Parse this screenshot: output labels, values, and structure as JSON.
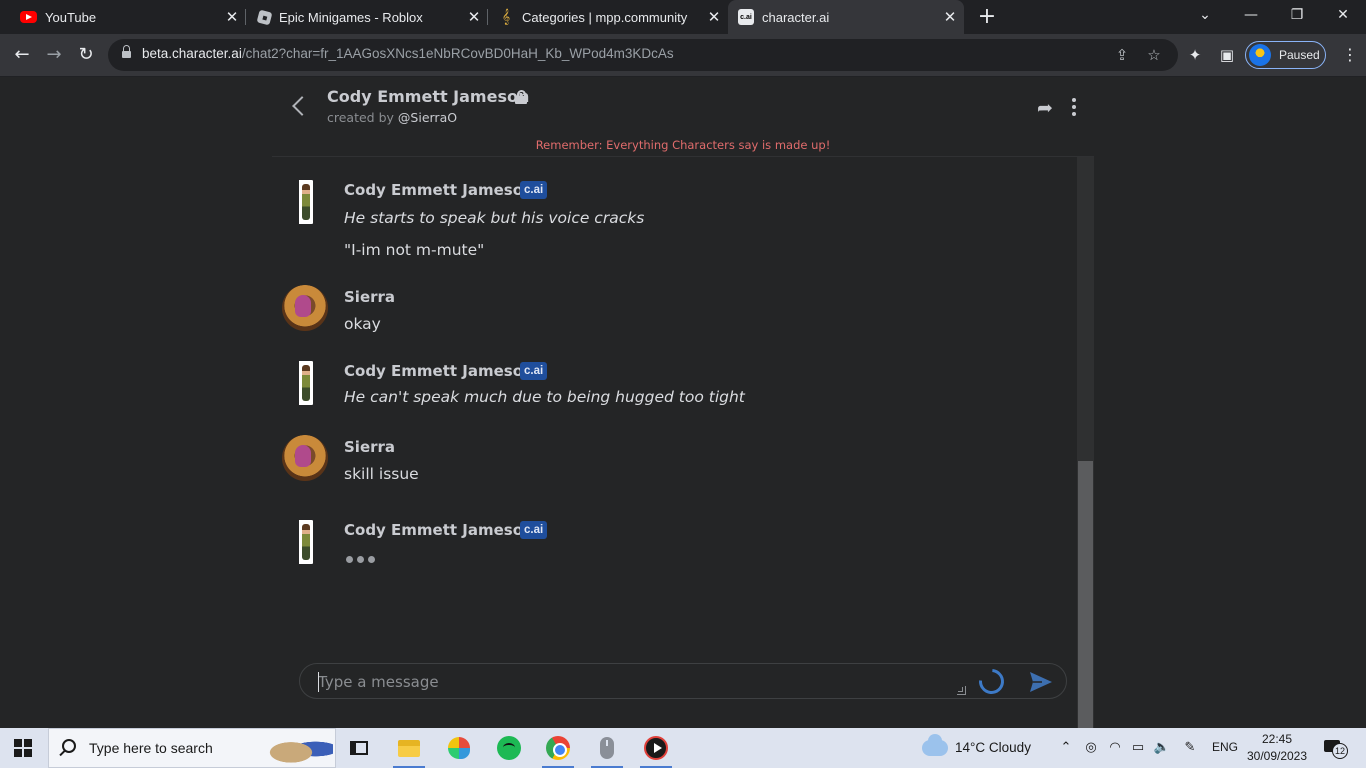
{
  "browser": {
    "tabs": [
      {
        "title": "YouTube",
        "favicon": "youtube-icon",
        "active": false
      },
      {
        "title": "Epic Minigames - Roblox",
        "favicon": "roblox-icon",
        "active": false
      },
      {
        "title": "Categories | mpp.community",
        "favicon": "music-note-icon",
        "active": false
      },
      {
        "title": "character.ai",
        "favicon": "cai-icon",
        "active": true
      }
    ],
    "new_tab_symbol": "+",
    "window_controls": {
      "chevron": "⌄",
      "minimize": "—",
      "restore": "❐",
      "close": "✕"
    },
    "address_host": "beta.character.ai",
    "address_path": "/chat2?char=fr_1AAGosXNcs1eNbRCovBD0HaH_Kb_WPod4m3KDcAs",
    "profile_status": "Paused",
    "nav_symbols": {
      "back": "←",
      "forward": "→",
      "reload": "↻"
    },
    "omnibox_icons": {
      "share": "⇪",
      "star": "☆"
    },
    "toolbar_icons": {
      "extensions": "✦",
      "sidepanel": "▣",
      "menu": "⋮"
    }
  },
  "chat": {
    "character_name": "Cody Emmett Jameson",
    "created_by_prefix": "created by",
    "creator_handle": "@SierraO",
    "disclaimer": "Remember: Everything Characters say is made up!",
    "share_symbol": "➦",
    "messages": [
      {
        "sender": "Cody Emmett Jameson",
        "badge": "c.ai",
        "lines": [
          {
            "text": "He starts to speak but his voice cracks",
            "italic": true
          },
          {
            "text": "\"I-im not m-mute\"",
            "italic": false
          }
        ]
      },
      {
        "sender": "Sierra",
        "lines": [
          {
            "text": "okay",
            "italic": false
          }
        ]
      },
      {
        "sender": "Cody Emmett Jameson",
        "badge": "c.ai",
        "lines": [
          {
            "text": "He can't speak much due to being hugged too tight",
            "italic": true
          }
        ]
      },
      {
        "sender": "Sierra",
        "lines": [
          {
            "text": "skill issue",
            "italic": false
          }
        ]
      },
      {
        "sender": "Cody Emmett Jameson",
        "badge": "c.ai",
        "typing": true
      }
    ],
    "input_placeholder": "Type a message",
    "accent_color": "#3d7ac7",
    "badge_color": "#1f4e9c",
    "disclaimer_color": "#e06c6c"
  },
  "taskbar": {
    "search_placeholder": "Type here to search",
    "apps": [
      "task-view-icon",
      "file-explorer-icon",
      "paint-icon",
      "spotify-icon",
      "chrome-icon",
      "mouse-app-icon",
      "media-player-icon"
    ],
    "weather": "14°C  Cloudy",
    "tray_symbols": {
      "chevron": "⌃",
      "meet": "◎",
      "wifi": "◠",
      "battery": "▭",
      "volume": "🔈",
      "pen": "✎"
    },
    "language": "ENG",
    "time": "22:45",
    "date": "30/09/2023",
    "notifications": "12"
  }
}
